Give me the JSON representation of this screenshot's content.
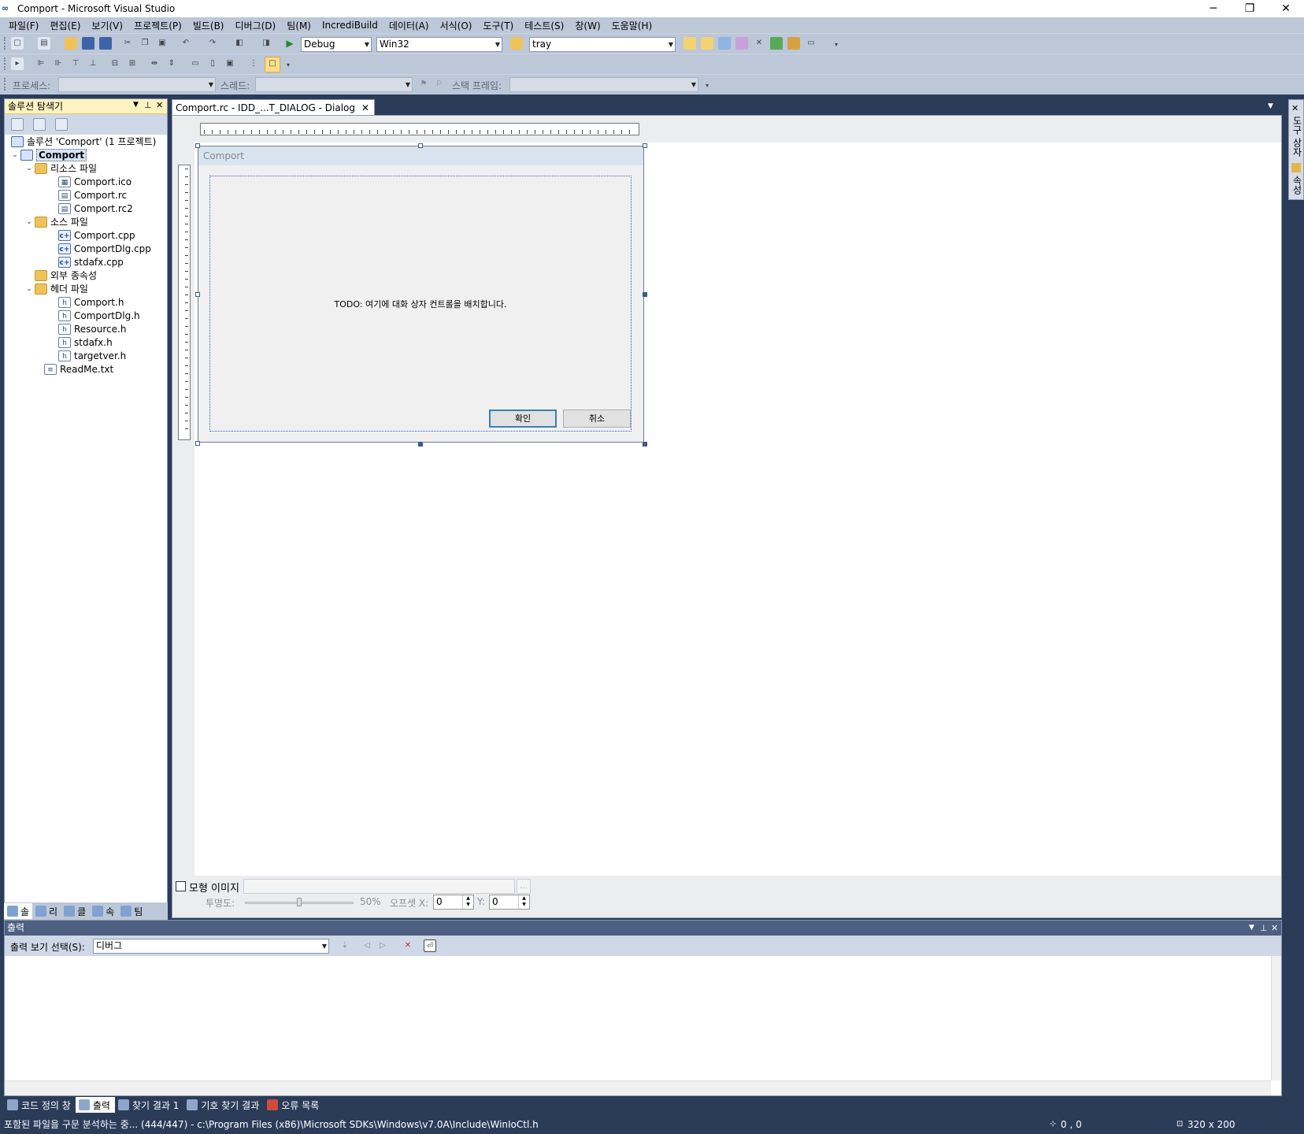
{
  "window": {
    "title": "Comport - Microsoft Visual Studio",
    "minimize": "─",
    "restore": "❐",
    "close": "✕"
  },
  "menu": [
    "파일(F)",
    "편집(E)",
    "보기(V)",
    "프로젝트(P)",
    "빌드(B)",
    "디버그(D)",
    "팀(M)",
    "IncrediBuild",
    "데이터(A)",
    "서식(O)",
    "도구(T)",
    "테스트(S)",
    "창(W)",
    "도움말(H)"
  ],
  "toolbar": {
    "configuration": "Debug",
    "platform": "Win32",
    "find": "tray"
  },
  "debug_toolbar": {
    "process_label": "프로세스:",
    "thread_label": "스레드:",
    "stack_frame_label": "스택 프레임:"
  },
  "solution_explorer": {
    "title": "솔루션 탐색기",
    "items": [
      {
        "label": "솔루션 'Comport' (1 프로젝트)"
      },
      {
        "label": "Comport"
      },
      {
        "label": "리소스 파일"
      },
      {
        "label": "Comport.ico"
      },
      {
        "label": "Comport.rc"
      },
      {
        "label": "Comport.rc2"
      },
      {
        "label": "소스 파일"
      },
      {
        "label": "Comport.cpp"
      },
      {
        "label": "ComportDlg.cpp"
      },
      {
        "label": "stdafx.cpp"
      },
      {
        "label": "외부 종속성"
      },
      {
        "label": "헤더 파일"
      },
      {
        "label": "Comport.h"
      },
      {
        "label": "ComportDlg.h"
      },
      {
        "label": "Resource.h"
      },
      {
        "label": "stdafx.h"
      },
      {
        "label": "targetver.h"
      },
      {
        "label": "ReadMe.txt"
      }
    ],
    "tabs": [
      "솔",
      "리",
      "클",
      "속",
      "팀"
    ]
  },
  "document_tab": "Comport.rc - IDD_...T_DIALOG - Dialog",
  "dialog": {
    "title": "Comport",
    "todo": "TODO: 여기에 대화 상자 컨트롤을 배치합니다.",
    "ok": "확인",
    "cancel": "취소"
  },
  "editor_bottom": {
    "mockup_label": "모형 이미지",
    "opacity_label": "투명도:",
    "opacity_value": "50%",
    "offset_x_label": "오프셋 X:",
    "offset_x": "0",
    "offset_y_label": "Y:",
    "offset_y": "0",
    "browse": "..."
  },
  "right_strip": {
    "toolbox": "도구 상자",
    "properties": "속성"
  },
  "output": {
    "title": "출력",
    "select_label": "출력 보기 선택(S):",
    "select_value": "디버그"
  },
  "bottom_tabs": [
    "코드 정의 창",
    "출력",
    "찾기 결과 1",
    "기호 찾기 결과",
    "오류 목록"
  ],
  "status": {
    "message": "포함된 파일을 구문 분석하는 중... (444/447) - c:\\Program Files (x86)\\Microsoft SDKs\\Windows\\v7.0A\\Include\\WinIoCtl.h",
    "position": "0 , 0",
    "size": "320 x 200"
  }
}
